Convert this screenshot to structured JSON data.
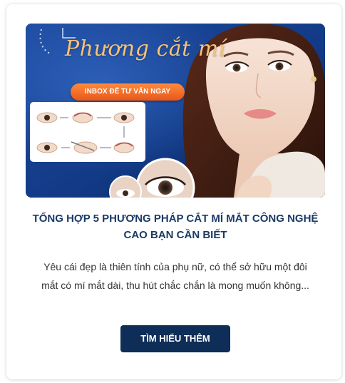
{
  "card": {
    "banner": {
      "script_text": "Phương cắt mí",
      "cta_text": "INBOX ĐỂ TƯ VẤN NGAY"
    },
    "title": "TỔNG HỢP 5 PHƯƠNG PHÁP CẮT MÍ MẮT CÔNG NGHỆ CAO BẠN CẦN BIẾT",
    "description": "Yêu cái đẹp là thiên tính của phụ nữ, có thể sở hữu một đôi mắt có mí mắt dài, thu hút chắc chắn là mong muốn không...",
    "button_label": "TÌM HIỂU THÊM"
  },
  "colors": {
    "title": "#1a3a66",
    "button": "#0e2d57",
    "banner_bg": "#0f2f6e",
    "banner_cta": "#e8571a",
    "script": "#f5c27a"
  }
}
